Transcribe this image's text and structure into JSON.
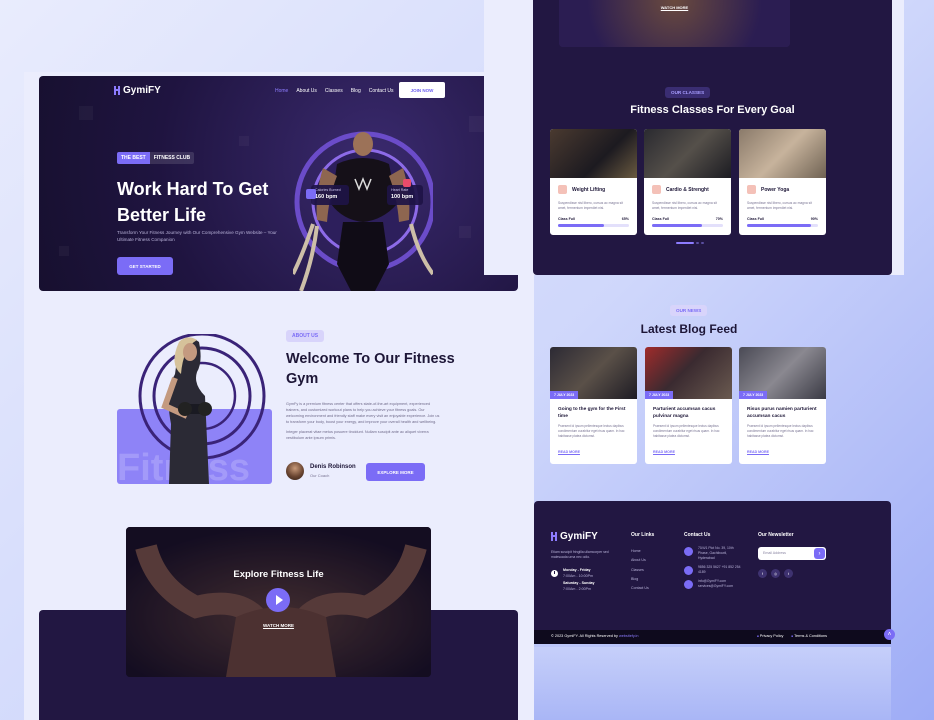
{
  "brand": {
    "name": "GymiFY",
    "accent": "#7b6cf6",
    "dark": "#221742"
  },
  "nav": {
    "items": [
      "Home",
      "About Us",
      "Classes",
      "Blog",
      "Contact Us"
    ],
    "join": "JOIN NOW"
  },
  "hero": {
    "badge1": "THE BEST",
    "badge2": "FITNESS CLUB",
    "title": "Work Hard To Get Better Life",
    "subtitle": "Transform Your Fitness Journey with Our Comprehensive Gym Website – Your Ultimate Fitness Companion",
    "cta": "GET STARTED",
    "stat1": {
      "label": "Calories Burned",
      "value": "160 bpm"
    },
    "stat2": {
      "label": "Heart Rate",
      "value": "100 bpm"
    }
  },
  "about": {
    "tag": "ABOUT US",
    "title": "Welcome To Our Fitness Gym",
    "p1": "GymFy is a premium fitness center that offers state-of-the-art equipment, experienced trainers, and customized workout plans to help you achieve your fitness goals. Our welcoming environment and friendly staff make every visit an enjoyable experience. Join us to transform your body, boost your energy, and improve your overall health and wellbeing.",
    "p2": "Integer placerat vitae metus posuere tincidunt. Nullam suscipit ante ac aliquet viverra vestibulum ante ipsum primis.",
    "name": "Denis Robinson",
    "role": "Our Coach",
    "cta": "EXPLORE MORE",
    "watermark": "Fitness"
  },
  "video": {
    "title": "Explore Fitness Life",
    "watch": "WATCH MORE"
  },
  "classes": {
    "tag": "OUR CLASSES",
    "title": "Fitness Classes For Every Goal",
    "items": [
      {
        "name": "Weight Lifting",
        "text": "Suspendisse nisl libero, cursus ac magna sit amet, fermentum imperdiet nisi.",
        "label": "Class Full",
        "pct": "65%",
        "fill": 0.65
      },
      {
        "name": "Cardio & Strenght",
        "text": "Suspendisse nisl libero, cursus ac magna sit amet, fermentum imperdiet nisi.",
        "label": "Class Full",
        "pct": "70%",
        "fill": 0.7
      },
      {
        "name": "Power Yoga",
        "text": "Suspendisse nisl libero, cursus ac magna sit amet, fermentum imperdiet nisi.",
        "label": "Class Full",
        "pct": "90%",
        "fill": 0.9
      }
    ]
  },
  "blog": {
    "tag": "OUR NEWS",
    "title": "Latest Blog Feed",
    "items": [
      {
        "date": "7 JULY 2023",
        "title": "Going to the gym for the First time",
        "text": "Praesent id ipsum pellentesque lectus dapibus condimentum curabitur eget risus quam. In hac habitasse platea dictumst.",
        "more": "READ MORE"
      },
      {
        "date": "7 JULY 2023",
        "title": "Parturient accumsan cacus pulvinar magna",
        "text": "Praesent id ipsum pellentesque lectus dapibus condimentum curabitur eget risus quam. In hac habitasse platea dictumst.",
        "more": "READ MORE"
      },
      {
        "date": "7 JULY 2023",
        "title": "Risus purus namien parturient accumsan cacus",
        "text": "Praesent id ipsum pellentesque lectus dapibus condimentum curabitur eget risus quam. In hac habitasse platea dictumst.",
        "more": "READ MORE"
      }
    ]
  },
  "footer": {
    "about": "Etiam suscipit fringilla ullamcorper sed malesuada urna nec odio.",
    "hours1_label": "Monday - Friday",
    "hours1": "7:00Am - 10:00Pm",
    "hours2_label": "Saturday - Sunday",
    "hours2": "7:00Am - 2:00Pm",
    "links_title": "Our Links",
    "links": [
      "Home",
      "About Us",
      "Classes",
      "Blog",
      "Contact Us"
    ],
    "contact_title": "Contact Us",
    "address": "70/4/1 Plot No. 39, 10th Phase, Gachibowli, Hyderabad",
    "phone": "9856 325 5627 +91 852 254 4189",
    "email": "info@GymiFY.com services@GymiFY.com",
    "newsletter_title": "Our Newsletter",
    "email_placeholder": "Email Address",
    "copyright": "© 2023 GymiFY. All Rights Reserved by",
    "copyright_link": "websitefy.in",
    "privacy": "Privacy Policy",
    "terms": "Terms & Conditions"
  }
}
